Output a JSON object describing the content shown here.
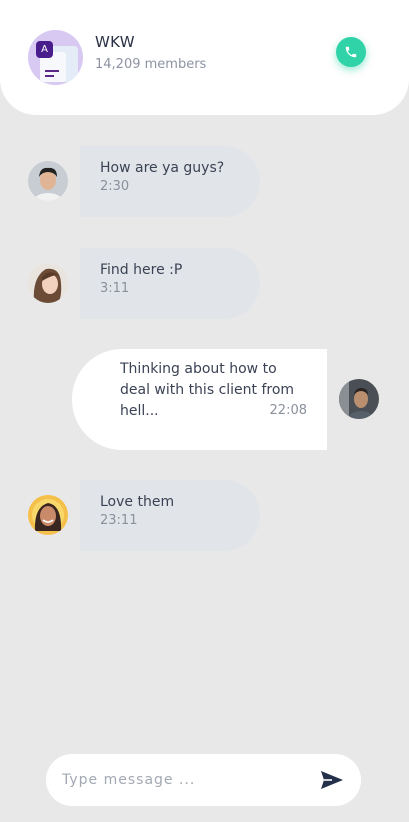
{
  "header": {
    "group_name": "WKW",
    "members": "14,209 members",
    "avatar_badge": "A",
    "call_icon": "phone-icon",
    "call_color": "#2fd3a7"
  },
  "messages": [
    {
      "side": "in",
      "text": "How are ya guys?",
      "time": "2:30",
      "avatar": "avatar-man-1"
    },
    {
      "side": "in",
      "text": "Find here :P",
      "time": "3:11",
      "avatar": "avatar-woman-1"
    },
    {
      "side": "out",
      "text": "Thinking about how to deal with this client from hell...",
      "time": "22:08",
      "avatar": "avatar-self"
    },
    {
      "side": "in",
      "text": "Love them",
      "time": "23:11",
      "avatar": "avatar-woman-2"
    }
  ],
  "composer": {
    "placeholder": "Type message ...",
    "value": "",
    "send_icon": "send-icon"
  },
  "colors": {
    "background": "#e8e8e8",
    "incoming_bubble": "#e1e5ea",
    "outgoing_bubble": "#ffffff",
    "accent": "#2fd3a7"
  }
}
